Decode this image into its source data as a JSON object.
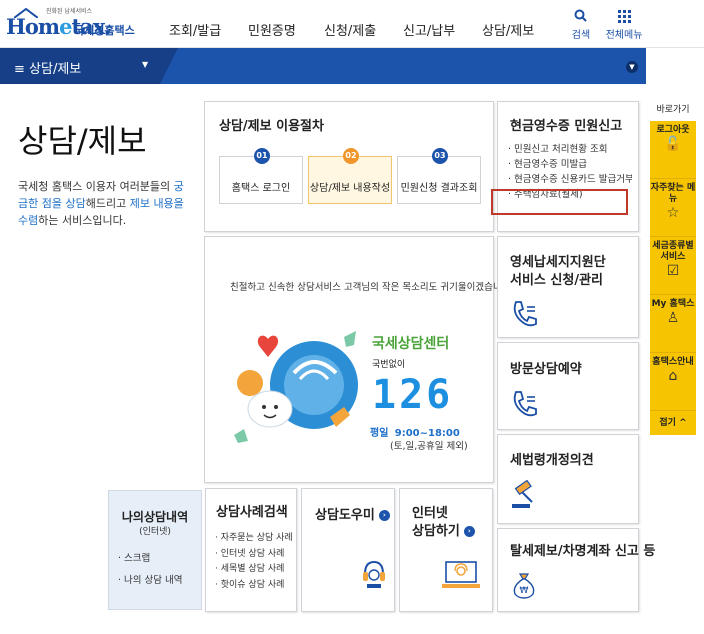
{
  "header": {
    "logo_slogan": "진화된 납세서비스",
    "logo_text": "Hometax",
    "logo_kr": "국세청홈택스",
    "nav": [
      "조회/발급",
      "민원증명",
      "신청/제출",
      "신고/납부",
      "상담/제보"
    ],
    "search_label": "검색",
    "menu_label": "전체메뉴"
  },
  "navbar": {
    "current": "상담/제보"
  },
  "page": {
    "title": "상담/제보",
    "desc_1": "국세청 홈택스 이용자 여러분들의 ",
    "desc_hl_1": "궁금한 점을 상담",
    "desc_2": "해드리고 ",
    "desc_hl_2": "제보 내용을 수렴",
    "desc_3": "하는 서비스입니다."
  },
  "procedure": {
    "title": "상담/제보 이용절차",
    "steps": [
      {
        "num": "01",
        "label": "홈택스 로그인"
      },
      {
        "num": "02",
        "label": "상담/제보 내용작성"
      },
      {
        "num": "03",
        "label": "민원신청 결과조회"
      }
    ]
  },
  "cash_receipt": {
    "title": "현금영수증 민원신고",
    "items": [
      "민원신고 처리현황 조회",
      "현금영수증 미발급",
      "현금영수증 신용카드 발급거부",
      "주택임차료(월세)"
    ]
  },
  "banner": {
    "text": "친절하고 신속한 상담서비스 고객님의 작은 목소리도 귀기울이겠습니다.",
    "center_title": "국세상담센터",
    "center_sub": "국번없이",
    "center_num": "126",
    "hours_label": "평일",
    "hours": "9:00~18:00",
    "holiday": "(토,일,공휴일 제외)"
  },
  "side_cards": [
    {
      "title_1": "영세납세지지원단",
      "title_2": "서비스 신청/관리"
    },
    {
      "title_1": "방문상담예약"
    },
    {
      "title_1": "세법령개정의견"
    },
    {
      "title_1": "탈세제보/차명계좌 신고 등"
    }
  ],
  "quick_menu": {
    "head": "바로가기",
    "items": [
      {
        "label": "로그아웃",
        "icon": "lock-icon",
        "glyph": "🔓"
      },
      {
        "label": "자주찾는 메뉴",
        "icon": "star-icon",
        "glyph": "☆"
      },
      {
        "label": "세금종류별 서비스",
        "icon": "checkbox-icon",
        "glyph": "☑"
      },
      {
        "label": "My 홈택스",
        "icon": "person-icon",
        "glyph": "♙"
      },
      {
        "label": "홈택스안내",
        "icon": "home-icon",
        "glyph": "⌂"
      }
    ],
    "fold": "접기 ^"
  },
  "bottom": {
    "my_title": "나의상담내역",
    "my_sub": "(인터넷)",
    "my_items": [
      "스크랩",
      "나의 상담 내역"
    ],
    "cases_title": "상담사례검색",
    "cases_items": [
      "자주묻는 상담 사례",
      "인터넷 상담 사례",
      "세목별 상담 사례",
      "핫이슈 상담 사례"
    ],
    "helper_title": "상담도우미",
    "internet_title_1": "인터넷",
    "internet_title_2": "상담하기"
  }
}
